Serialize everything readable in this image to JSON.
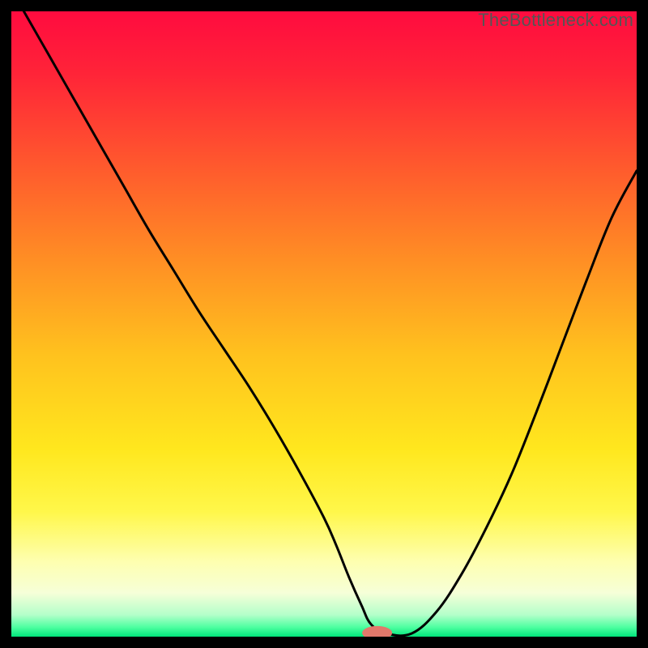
{
  "watermark": "TheBottleneck.com",
  "colors": {
    "bg_black": "#000000",
    "curve": "#000000",
    "marker_fill": "#e2786b",
    "gradient_stops": [
      {
        "offset": 0.0,
        "color": "#ff0b3f"
      },
      {
        "offset": 0.1,
        "color": "#ff2438"
      },
      {
        "offset": 0.25,
        "color": "#ff5a2d"
      },
      {
        "offset": 0.4,
        "color": "#ff8f24"
      },
      {
        "offset": 0.55,
        "color": "#ffc21e"
      },
      {
        "offset": 0.7,
        "color": "#ffe71e"
      },
      {
        "offset": 0.8,
        "color": "#fff74a"
      },
      {
        "offset": 0.88,
        "color": "#feffb0"
      },
      {
        "offset": 0.93,
        "color": "#f6ffd8"
      },
      {
        "offset": 0.965,
        "color": "#b4ffca"
      },
      {
        "offset": 0.985,
        "color": "#4dffa0"
      },
      {
        "offset": 1.0,
        "color": "#00e57a"
      }
    ]
  },
  "chart_data": {
    "type": "line",
    "title": "",
    "xlabel": "",
    "ylabel": "",
    "xlim": [
      0,
      100
    ],
    "ylim": [
      0,
      100
    ],
    "grid": false,
    "legend": false,
    "series": [
      {
        "name": "bottleneck-curve",
        "x": [
          2,
          6,
          10,
          14,
          18,
          22,
          26,
          30,
          34,
          38,
          42,
          46,
          50,
          52,
          54,
          56,
          57.5,
          60,
          64,
          68,
          72,
          76,
          80,
          84,
          88,
          92,
          96,
          100
        ],
        "values": [
          100,
          93,
          86,
          79,
          72,
          65,
          58.5,
          52,
          46,
          40,
          33.5,
          26.5,
          19,
          14.5,
          9.5,
          5,
          2,
          0.5,
          0.5,
          4,
          10,
          17.5,
          26,
          36,
          46.5,
          57,
          67,
          74.5
        ]
      }
    ],
    "marker": {
      "x": 58.5,
      "y": 0.6,
      "rx": 2.4,
      "ry": 1.1
    }
  }
}
